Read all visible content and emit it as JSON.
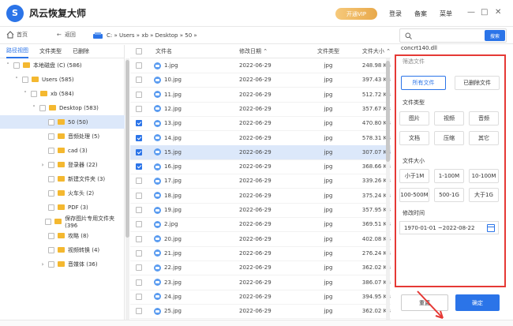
{
  "app": {
    "title": "风云恢复大师",
    "vip": "开通VIP",
    "login": "登录",
    "backup": "备案",
    "menu": "菜单",
    "minimize": "—",
    "maximize": "□",
    "close": "✕"
  },
  "nav": {
    "home": "首页",
    "back": "返回",
    "path": "C: » Users » xb » Desktop » 50 »",
    "search_placeholder": "",
    "search_btn": "搜索"
  },
  "left": {
    "tabs": [
      "路径视图",
      "文件类型",
      "已删除"
    ],
    "tree": [
      {
        "label": "本地磁盘 (C) (586)",
        "level": 0,
        "expand": "˅"
      },
      {
        "label": "Users (585)",
        "level": 1,
        "expand": "˅"
      },
      {
        "label": "xb (584)",
        "level": 2,
        "expand": "˅"
      },
      {
        "label": "Desktop (583)",
        "level": 3,
        "expand": "˅"
      },
      {
        "label": "50 (50)",
        "level": 4,
        "expand": ""
      },
      {
        "label": "音频处理 (5)",
        "level": 4,
        "expand": ""
      },
      {
        "label": "cad (3)",
        "level": 4,
        "expand": ""
      },
      {
        "label": "登录器 (22)",
        "level": 4,
        "expand": "›"
      },
      {
        "label": "新建文件夹 (3)",
        "level": 4,
        "expand": ""
      },
      {
        "label": "火车头 (2)",
        "level": 4,
        "expand": ""
      },
      {
        "label": "PDF (3)",
        "level": 4,
        "expand": ""
      },
      {
        "label": "保存图片专用文件夹 (396",
        "level": 4,
        "expand": ""
      },
      {
        "label": "攻略 (8)",
        "level": 4,
        "expand": ""
      },
      {
        "label": "视频转换 (4)",
        "level": 4,
        "expand": ""
      },
      {
        "label": "音媒体 (36)",
        "level": 4,
        "expand": "›"
      }
    ]
  },
  "table": {
    "headers": {
      "name": "文件名",
      "date": "修改日期 ⌃",
      "type": "文件类型",
      "size": "文件大小 ⌃"
    },
    "rows": [
      {
        "name": "1.jpg",
        "date": "2022-06-29",
        "type": "jpg",
        "size": "248.98 KB",
        "checked": false
      },
      {
        "name": "10.jpg",
        "date": "2022-06-29",
        "type": "jpg",
        "size": "397.43 KB",
        "checked": false
      },
      {
        "name": "11.jpg",
        "date": "2022-06-29",
        "type": "jpg",
        "size": "512.72 KB",
        "checked": false
      },
      {
        "name": "12.jpg",
        "date": "2022-06-29",
        "type": "jpg",
        "size": "357.67 KB",
        "checked": false
      },
      {
        "name": "13.jpg",
        "date": "2022-06-29",
        "type": "jpg",
        "size": "470.80 KB",
        "checked": true
      },
      {
        "name": "14.jpg",
        "date": "2022-06-29",
        "type": "jpg",
        "size": "578.31 KB",
        "checked": true
      },
      {
        "name": "15.jpg",
        "date": "2022-06-29",
        "type": "jpg",
        "size": "307.07 KB",
        "checked": true
      },
      {
        "name": "16.jpg",
        "date": "2022-06-29",
        "type": "jpg",
        "size": "368.66 KB",
        "checked": true
      },
      {
        "name": "17.jpg",
        "date": "2022-06-29",
        "type": "jpg",
        "size": "339.26 KB",
        "checked": false
      },
      {
        "name": "18.jpg",
        "date": "2022-06-29",
        "type": "jpg",
        "size": "375.24 KB",
        "checked": false
      },
      {
        "name": "19.jpg",
        "date": "2022-06-29",
        "type": "jpg",
        "size": "357.95 KB",
        "checked": false
      },
      {
        "name": "2.jpg",
        "date": "2022-06-29",
        "type": "jpg",
        "size": "369.51 KB",
        "checked": false
      },
      {
        "name": "20.jpg",
        "date": "2022-06-29",
        "type": "jpg",
        "size": "402.08 KB",
        "checked": false
      },
      {
        "name": "21.jpg",
        "date": "2022-06-29",
        "type": "jpg",
        "size": "276.24 KB",
        "checked": false
      },
      {
        "name": "22.jpg",
        "date": "2022-06-29",
        "type": "jpg",
        "size": "362.02 KB",
        "checked": false
      },
      {
        "name": "23.jpg",
        "date": "2022-06-29",
        "type": "jpg",
        "size": "386.07 KB",
        "checked": false
      },
      {
        "name": "24.jpg",
        "date": "2022-06-29",
        "type": "jpg",
        "size": "394.95 KB",
        "checked": false
      },
      {
        "name": "25.jpg",
        "date": "2022-06-29",
        "type": "jpg",
        "size": "362.02 KB",
        "checked": false
      }
    ]
  },
  "filter": {
    "suggestion": "concrt140.dll",
    "hidden_label": "筛选文件",
    "all_files": "所有文件",
    "deleted_files": "已删除文件",
    "type_label": "文件类型",
    "types": [
      "图片",
      "视频",
      "音频",
      "文档",
      "压缩",
      "其它"
    ],
    "size_label": "文件大小",
    "sizes": [
      "小于1M",
      "1-100M",
      "10-100M",
      "100-500M",
      "500-1G",
      "大于1G"
    ],
    "time_label": "修改时间",
    "date_range": "1970-01-01 ~2022-08-22",
    "reset": "重置",
    "confirm": "确定"
  }
}
